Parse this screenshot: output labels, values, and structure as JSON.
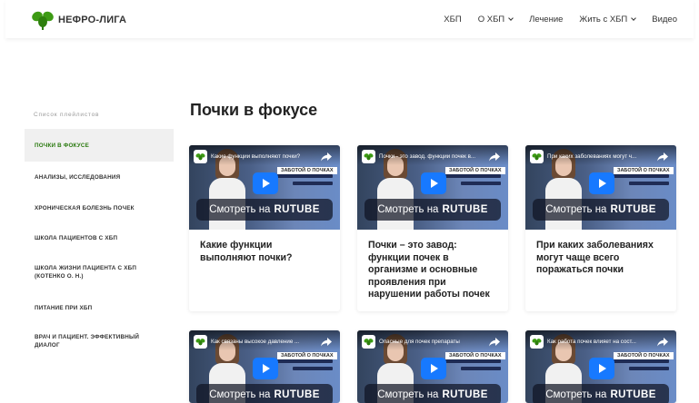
{
  "header": {
    "logo_text": "НЕФРО-ЛИГА",
    "nav": [
      {
        "label": "ХБП",
        "dropdown": false
      },
      {
        "label": "О ХБП",
        "dropdown": true
      },
      {
        "label": "Лечение",
        "dropdown": false
      },
      {
        "label": "Жить с ХБП",
        "dropdown": true
      },
      {
        "label": "Видео",
        "dropdown": false
      }
    ]
  },
  "sidebar": {
    "caption": "Список плейлистов",
    "items": [
      {
        "label": "Почки в фокусе",
        "active": true
      },
      {
        "label": "Анализы, исследования",
        "active": false
      },
      {
        "label": "Хроническая болезнь почек",
        "active": false
      },
      {
        "label": "Школа пациентов с ХБП",
        "active": false
      },
      {
        "label": "Школа жизни пациента с ХБП (Котенко О. Н.)",
        "active": false
      },
      {
        "label": "Питание при ХБП",
        "active": false
      },
      {
        "label": "Врач и пациент. Эффективный диалог",
        "active": false
      }
    ]
  },
  "main": {
    "title": "Почки в фокусе",
    "watch_prefix": "Смотреть на",
    "watch_brand": "RUTUBE",
    "tag_text": "ЗАБОТОЙ О ПОЧКАХ",
    "videos": [
      {
        "video_title": "Какие функции выполняют почки?",
        "card_title": "Какие функции выполняют почки?"
      },
      {
        "video_title": "Почки - это завод. функции почек в...",
        "card_title": "Почки – это завод: функции почек в организме и основные проявления при нарушении работы почек"
      },
      {
        "video_title": "При каких заболеваниях могут ч...",
        "card_title": "При каких заболеваниях могут чаще всего поражаться почки"
      },
      {
        "video_title": "Как связаны высокое давление ...",
        "card_title": ""
      },
      {
        "video_title": "Опасные для почек препараты",
        "card_title": ""
      },
      {
        "video_title": "Как работа почек влияет на сост...",
        "card_title": ""
      }
    ]
  },
  "colors": {
    "accent_green": "#2a7a0f",
    "play_blue": "#1779ff"
  }
}
